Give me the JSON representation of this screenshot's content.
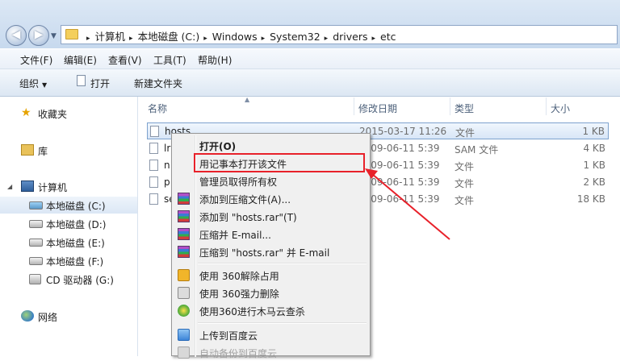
{
  "address_bar": {
    "back_glyph": "◀",
    "forward_glyph": "▶",
    "dropdown_glyph": "▼",
    "crumb_sep": "▸",
    "path": [
      "计算机",
      "本地磁盘 (C:)",
      "Windows",
      "System32",
      "drivers",
      "etc"
    ]
  },
  "menu": {
    "file": "文件(F)",
    "edit": "编辑(E)",
    "view": "查看(V)",
    "tools": "工具(T)",
    "help": "帮助(H)"
  },
  "toolbar": {
    "organize": "组织",
    "organize_arrow": "▼",
    "open": "打开",
    "new_folder": "新建文件夹"
  },
  "nav": {
    "favorites": "收藏夹",
    "libraries": "库",
    "computer": "计算机",
    "expand_glyph": "◢",
    "drives": [
      {
        "label": "本地磁盘 (C:)"
      },
      {
        "label": "本地磁盘 (D:)"
      },
      {
        "label": "本地磁盘 (E:)"
      },
      {
        "label": "本地磁盘 (F:)"
      },
      {
        "label": "CD 驱动器 (G:)"
      }
    ],
    "network": "网络"
  },
  "columns": {
    "name": "名称",
    "modified": "修改日期",
    "type": "类型",
    "size": "大小",
    "sort_glyph": "▲"
  },
  "files": [
    {
      "name": "hosts",
      "date": "2015-03-17 11:26",
      "type": "文件",
      "size": "1 KB"
    },
    {
      "name": "lr",
      "date": "2009-06-11 5:39",
      "type": "SAM 文件",
      "size": "4 KB"
    },
    {
      "name": "n",
      "date": "2009-06-11 5:39",
      "type": "文件",
      "size": "1 KB"
    },
    {
      "name": "p",
      "date": "2009-06-11 5:39",
      "type": "文件",
      "size": "2 KB"
    },
    {
      "name": "se",
      "date": "2009-06-11 5:39",
      "type": "文件",
      "size": "18 KB"
    }
  ],
  "context_menu": {
    "open": "打开(O)",
    "open_with_notepad": "用记事本打开该文件",
    "take_ownership": "管理员取得所有权",
    "add_to_archive": "添加到压缩文件(A)...",
    "add_to_hosts_rar": "添加到 \"hosts.rar\"(T)",
    "compress_email": "压缩并 E-mail...",
    "compress_to_hosts_rar_email": "压缩到 \"hosts.rar\" 并 E-mail",
    "use_360_unlock": "使用 360解除占用",
    "use_360_force_delete": "使用 360强力删除",
    "use_360_trojan_scan": "使用360进行木马云查杀",
    "upload_to_baidu": "上传到百度云",
    "auto_backup_baidu": "自动备份到百度云"
  },
  "colors": {
    "highlight_box": "#e8212a",
    "annotation_arrow": "#e8212a",
    "selection_border": "#7da2ce"
  }
}
